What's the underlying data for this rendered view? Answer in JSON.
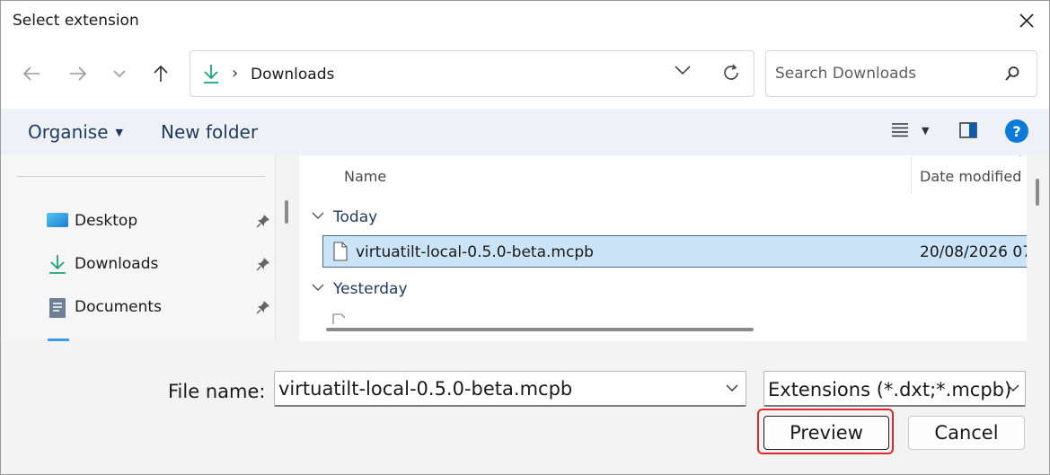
{
  "window": {
    "title": "Select extension"
  },
  "address_bar": {
    "crumb": "Downloads"
  },
  "search": {
    "placeholder": "Search Downloads"
  },
  "toolbar": {
    "organise_label": "Organise",
    "new_folder_label": "New folder"
  },
  "nav_pane": {
    "items": [
      {
        "label": "Desktop",
        "icon": "desktop-icon"
      },
      {
        "label": "Downloads",
        "icon": "download-icon"
      },
      {
        "label": "Documents",
        "icon": "documents-icon"
      }
    ]
  },
  "file_list": {
    "columns": {
      "name": "Name",
      "date_modified": "Date modified"
    },
    "groups": [
      {
        "label": "Today",
        "files": [
          {
            "name": "virtuatilt-local-0.5.0-beta.mcpb",
            "date": "20/08/2026 07"
          }
        ]
      },
      {
        "label": "Yesterday",
        "files": []
      }
    ]
  },
  "footer": {
    "file_name_label": "File name:",
    "file_name_value": "virtuatilt-local-0.5.0-beta.mcpb",
    "file_type": "Extensions (*.dxt;*.mcpb)",
    "preview_label": "Preview",
    "cancel_label": "Cancel"
  },
  "colors": {
    "accent": "#0b7ad8",
    "selection": "#cce4f7",
    "focus_ring": "#e0262e"
  }
}
